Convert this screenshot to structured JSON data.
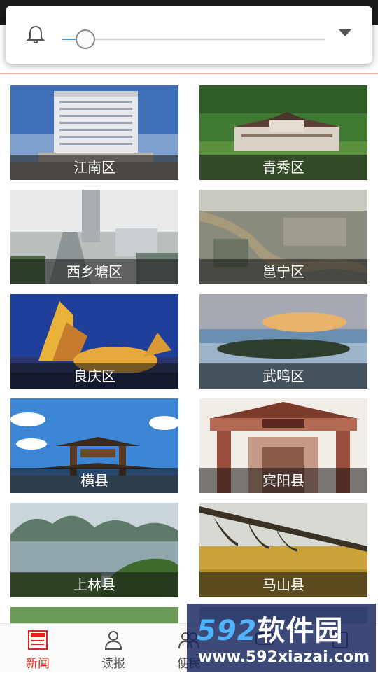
{
  "notification_popup": {
    "slider": {
      "value_fraction": 0.09
    }
  },
  "districts": [
    {
      "label": "江南区"
    },
    {
      "label": "青秀区"
    },
    {
      "label": "西乡塘区"
    },
    {
      "label": "邕宁区"
    },
    {
      "label": "良庆区"
    },
    {
      "label": "武鸣区"
    },
    {
      "label": "横县"
    },
    {
      "label": "宾阳县"
    },
    {
      "label": "上林县"
    },
    {
      "label": "马山县"
    }
  ],
  "bottom_nav": [
    {
      "label": "新闻",
      "icon": "news-icon",
      "active": true
    },
    {
      "label": "读报",
      "icon": "reader-icon",
      "active": false
    },
    {
      "label": "便民",
      "icon": "people-icon",
      "active": false
    },
    {
      "label": "",
      "icon": "chat-icon",
      "active": false
    },
    {
      "label": "",
      "icon": "profile-icon",
      "active": false
    }
  ],
  "watermark": {
    "logo_number": "592",
    "logo_text": "软件园",
    "url": "www.592xiazai.com"
  },
  "colors": {
    "accent": "#d9261c",
    "slider": "#4a90e2"
  }
}
